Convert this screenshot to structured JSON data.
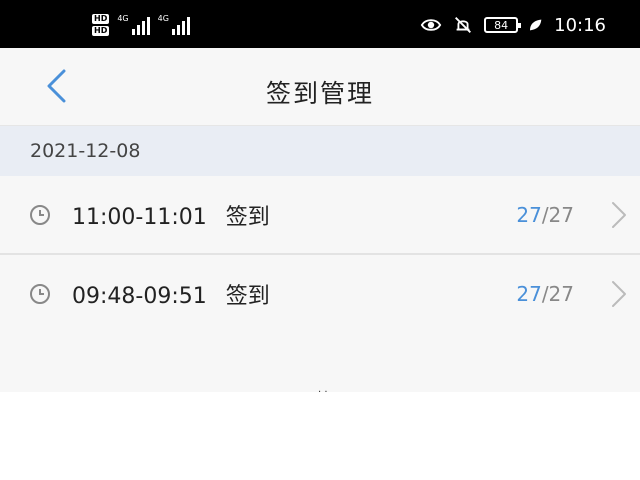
{
  "status_bar": {
    "hd1": "HD",
    "hd2": "HD",
    "net1": "4G",
    "net2": "4G",
    "battery": "84",
    "time": "10:16"
  },
  "nav": {
    "title": "签到管理"
  },
  "section": {
    "date": "2021-12-08"
  },
  "sessions": [
    {
      "time_range": "11:00-11:01",
      "label": "签到",
      "checked": "27",
      "total": "/27"
    },
    {
      "time_range": "09:48-09:51",
      "label": "签到",
      "checked": "27",
      "total": "/27"
    }
  ],
  "colors": {
    "accent": "#4a90d9",
    "nav_bg": "#f7f7f7",
    "section_bg": "#e9edf4"
  }
}
